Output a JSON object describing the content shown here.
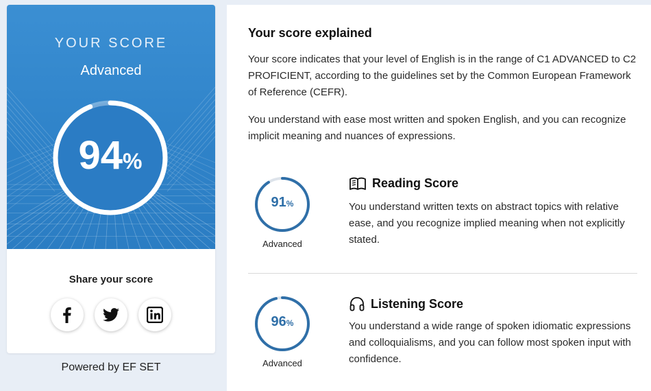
{
  "score_card": {
    "title": "YOUR SCORE",
    "level": "Advanced",
    "score": 94,
    "score_value": "94",
    "percent_sign": "%",
    "ring_color": "#ffffff",
    "hero_color": "#3b8fd3"
  },
  "share": {
    "title": "Share your score",
    "buttons": [
      {
        "icon": "facebook-icon"
      },
      {
        "icon": "twitter-icon"
      },
      {
        "icon": "linkedin-icon"
      }
    ]
  },
  "footer": {
    "powered_by": "Powered by EF SET"
  },
  "explanation": {
    "title": "Your score explained",
    "paragraph_1": "Your score indicates that your level of English is in the range of C1 ADVANCED to C2 PROFICIENT, according to the guidelines set by the Common European Framework of Reference (CEFR).",
    "paragraph_2": "You understand with ease most written and spoken English, and you can recognize implicit meaning and nuances of expressions."
  },
  "reading": {
    "icon": "book-icon",
    "heading": "Reading Score",
    "score": 91,
    "score_value": "91",
    "percent_sign": "%",
    "level": "Advanced",
    "description": "You understand written texts on abstract topics with relative ease, and you recognize implied meaning when not explicitly stated."
  },
  "listening": {
    "icon": "headphones-icon",
    "heading": "Listening Score",
    "score": 96,
    "score_value": "96",
    "percent_sign": "%",
    "level": "Advanced",
    "description": "You understand a wide range of spoken idiomatic expressions and colloquialisms, and you can follow most spoken input with confidence."
  },
  "colors": {
    "accent": "#2f83c9",
    "sub_ring": "#2f6fa8",
    "ring_track": "#dde3ea"
  }
}
